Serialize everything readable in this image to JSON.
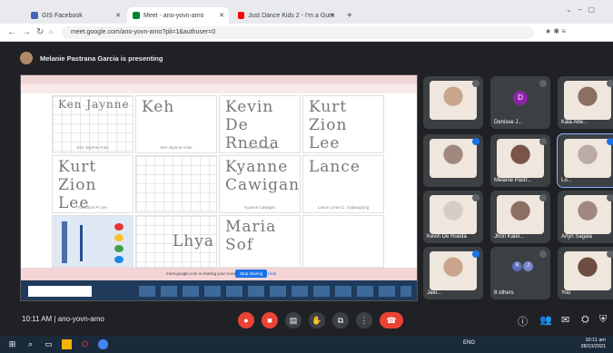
{
  "browser": {
    "tabs": [
      {
        "label": "GIS Facebook",
        "active": false
      },
      {
        "label": "Meet - ano-yovn-amo",
        "active": true
      },
      {
        "label": "Just Dance Kids 2 - I'm a Gum",
        "active": false
      }
    ],
    "url": "meet.google.com/ano-yovn-amo?pli=1&authuser=0"
  },
  "presenter": {
    "text": "Melanie Pastrana Garcia is presenting"
  },
  "shared_screen": {
    "cells": [
      {
        "handwriting": "Ken Jaynne",
        "caption": "Ken Jaynne Arias"
      },
      {
        "handwriting": "Keh",
        "caption": "Ken Jaynne Arias"
      },
      {
        "handwriting": "Kevin De Rneda",
        "caption": "Kevin De Rueda"
      },
      {
        "handwriting": "Kurt Zion Lee",
        "caption": ""
      },
      {
        "handwriting": "Kurt Zion Lee",
        "caption": "Kurt Zion P. Lee"
      },
      {
        "handwriting": "",
        "caption": ""
      },
      {
        "handwriting": "Kyanne Cawigan",
        "caption": "Kyanne Cawigan"
      },
      {
        "handwriting": "Lance",
        "caption": "Lance Loran C. Cabanglong"
      },
      {
        "handwriting": "",
        "caption": ""
      },
      {
        "handwriting": "Lhya",
        "caption": ""
      },
      {
        "handwriting": "Maria Sof",
        "caption": ""
      },
      {
        "handwriting": "",
        "caption": ""
      }
    ],
    "share_notice": "meet.google.com is sharing your screen",
    "stop_label": "Stop sharing",
    "hide_label": "Hide"
  },
  "participants": [
    {
      "name": "",
      "mic_on": false
    },
    {
      "name": "Denisse J...",
      "initial": "D",
      "mic_on": false
    },
    {
      "name": "Kaia Abe...",
      "mic_on": false
    },
    {
      "name": "",
      "mic_on": true
    },
    {
      "name": "Melanie Pastr...",
      "mic_on": false
    },
    {
      "name": "Lo...",
      "mic_on": true
    },
    {
      "name": "Kevin De Rueda",
      "mic_on": false
    },
    {
      "name": "Jhon Kalel...",
      "mic_on": false
    },
    {
      "name": "Arlyn Sagala",
      "mic_on": false
    },
    {
      "name": "Jaei...",
      "mic_on": true
    },
    {
      "name": "8 others",
      "initial": "R",
      "initial2": "J",
      "mic_on": false
    },
    {
      "name": "You",
      "mic_on": false
    }
  ],
  "bottom": {
    "time_code": "10:11 AM | ano-yovn-amo"
  },
  "taskbar": {
    "clock_time": "10:11 am",
    "clock_date": "28/10/2021",
    "lang": "ENG"
  },
  "colors": {
    "meet_bg": "#202124",
    "end_call": "#ea4335",
    "accent": "#1a73e8"
  }
}
